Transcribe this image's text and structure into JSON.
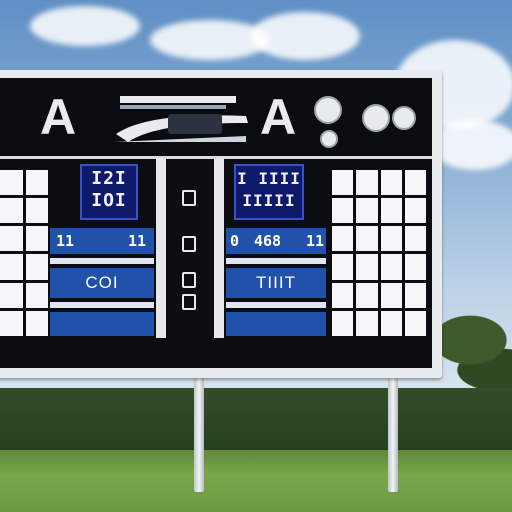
{
  "sign": {
    "logo_left": "A",
    "logo_right": "A",
    "left_screen_text": "I2I\nIOI",
    "right_screen_text": "I IIII\nIIIII",
    "left_stripe_text_a": "11",
    "left_stripe_text_b": "11",
    "right_stripe_text_a": "0",
    "right_stripe_text_b": "468",
    "right_stripe_text_c": "11",
    "left_team": "COI",
    "right_team": "TIIIT"
  },
  "colors": {
    "panel": "#0b0d12",
    "accent_blue": "#1f52a8",
    "frame": "#e9ecef"
  }
}
